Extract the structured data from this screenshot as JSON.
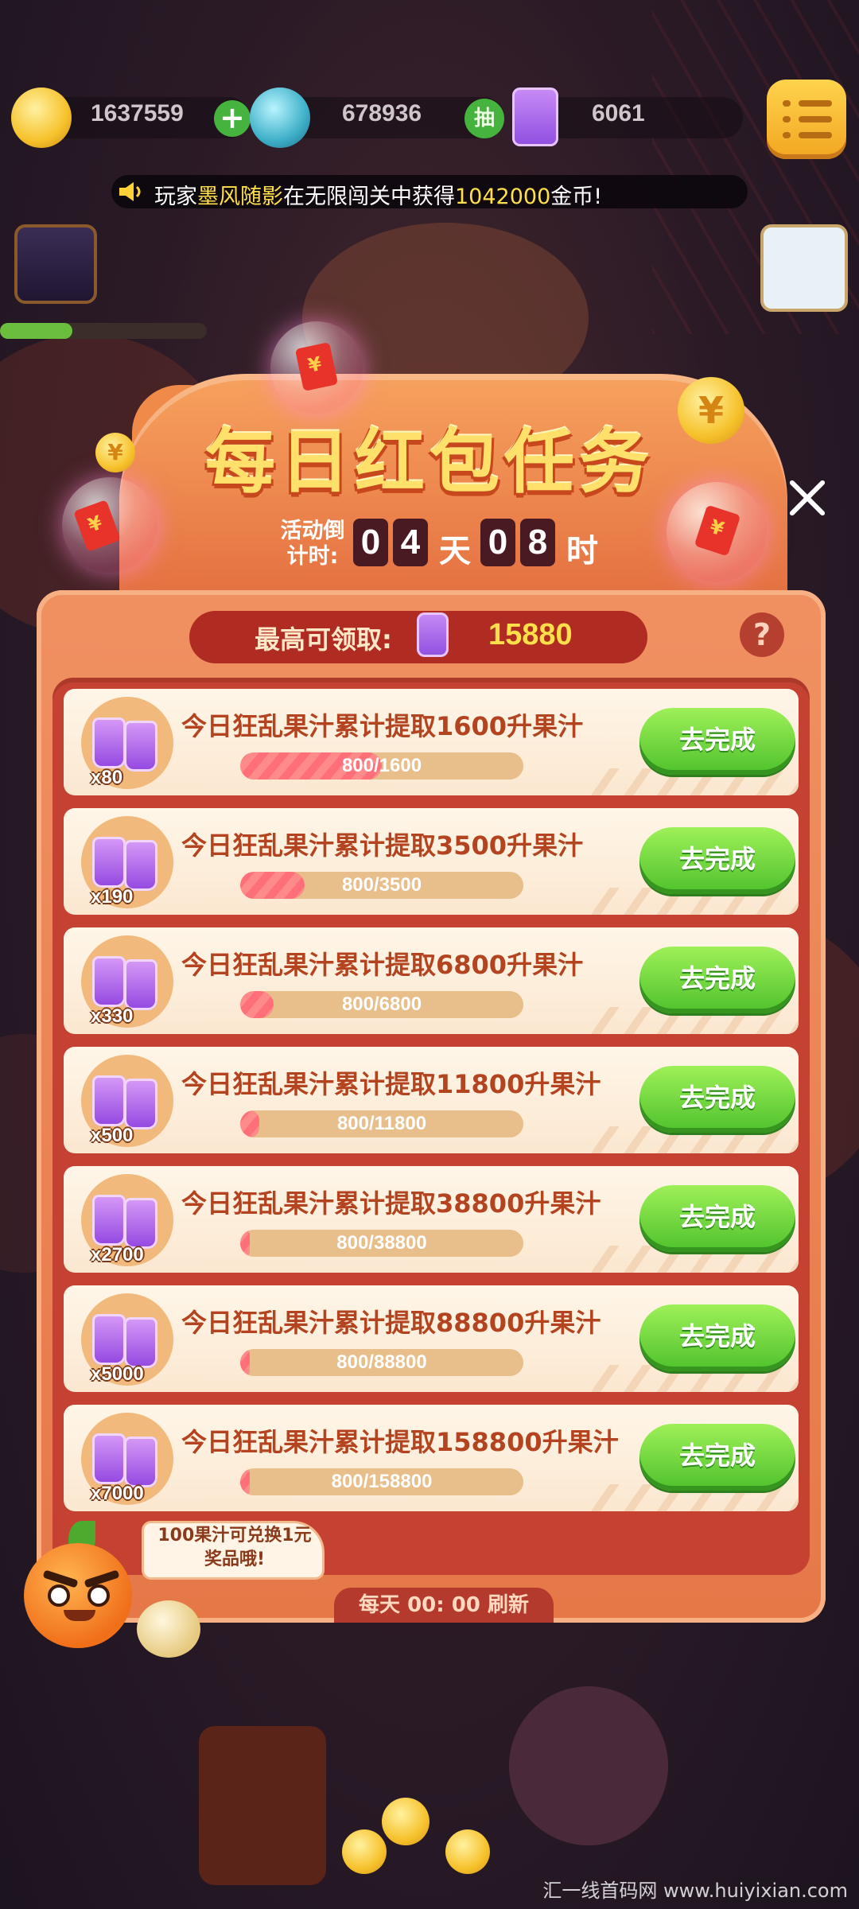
{
  "topbar": {
    "coins": "1637559",
    "gems": "678936",
    "draw_label": "抽",
    "juice": "6061"
  },
  "broadcast": {
    "prefix": "玩家",
    "player": "墨风随影",
    "middle": "在无限闯关中获得",
    "amount": "1042000",
    "suffix": "金币!"
  },
  "header": {
    "title": "每日红包任务",
    "countdown_label": "活动倒计时:",
    "days_digit1": "0",
    "days_digit2": "4",
    "days_unit": "天",
    "hours_digit1": "0",
    "hours_digit2": "8",
    "hours_unit": "时"
  },
  "summary": {
    "label": "最高可领取:",
    "value": "15880",
    "help": "?"
  },
  "tasks": [
    {
      "title": "今日狂乱果汁累计提取1600升果汁",
      "reward": "x80",
      "progress": "800/1600",
      "ratio": 0.5,
      "button": "去完成"
    },
    {
      "title": "今日狂乱果汁累计提取3500升果汁",
      "reward": "x190",
      "progress": "800/3500",
      "ratio": 0.2286,
      "button": "去完成"
    },
    {
      "title": "今日狂乱果汁累计提取6800升果汁",
      "reward": "x330",
      "progress": "800/6800",
      "ratio": 0.1176,
      "button": "去完成"
    },
    {
      "title": "今日狂乱果汁累计提取11800升果汁",
      "reward": "x500",
      "progress": "800/11800",
      "ratio": 0.0678,
      "button": "去完成"
    },
    {
      "title": "今日狂乱果汁累计提取38800升果汁",
      "reward": "x2700",
      "progress": "800/38800",
      "ratio": 0.0206,
      "button": "去完成"
    },
    {
      "title": "今日狂乱果汁累计提取88800升果汁",
      "reward": "x5000",
      "progress": "800/88800",
      "ratio": 0.009,
      "button": "去完成"
    },
    {
      "title": "今日狂乱果汁累计提取158800升果汁",
      "reward": "x7000",
      "progress": "800/158800",
      "ratio": 0.005,
      "button": "去完成"
    }
  ],
  "mascot_tip": "100果汁可兑换1元奖品哦!",
  "refresh_note": "每天 00: 00 刷新",
  "watermark": "汇一线首码网 www.huiyixian.com",
  "colors": {
    "accent_yellow": "#ffe04a",
    "button_green": "#4ec12c",
    "panel_red": "#c54131",
    "modal_orange": "#e67848"
  }
}
